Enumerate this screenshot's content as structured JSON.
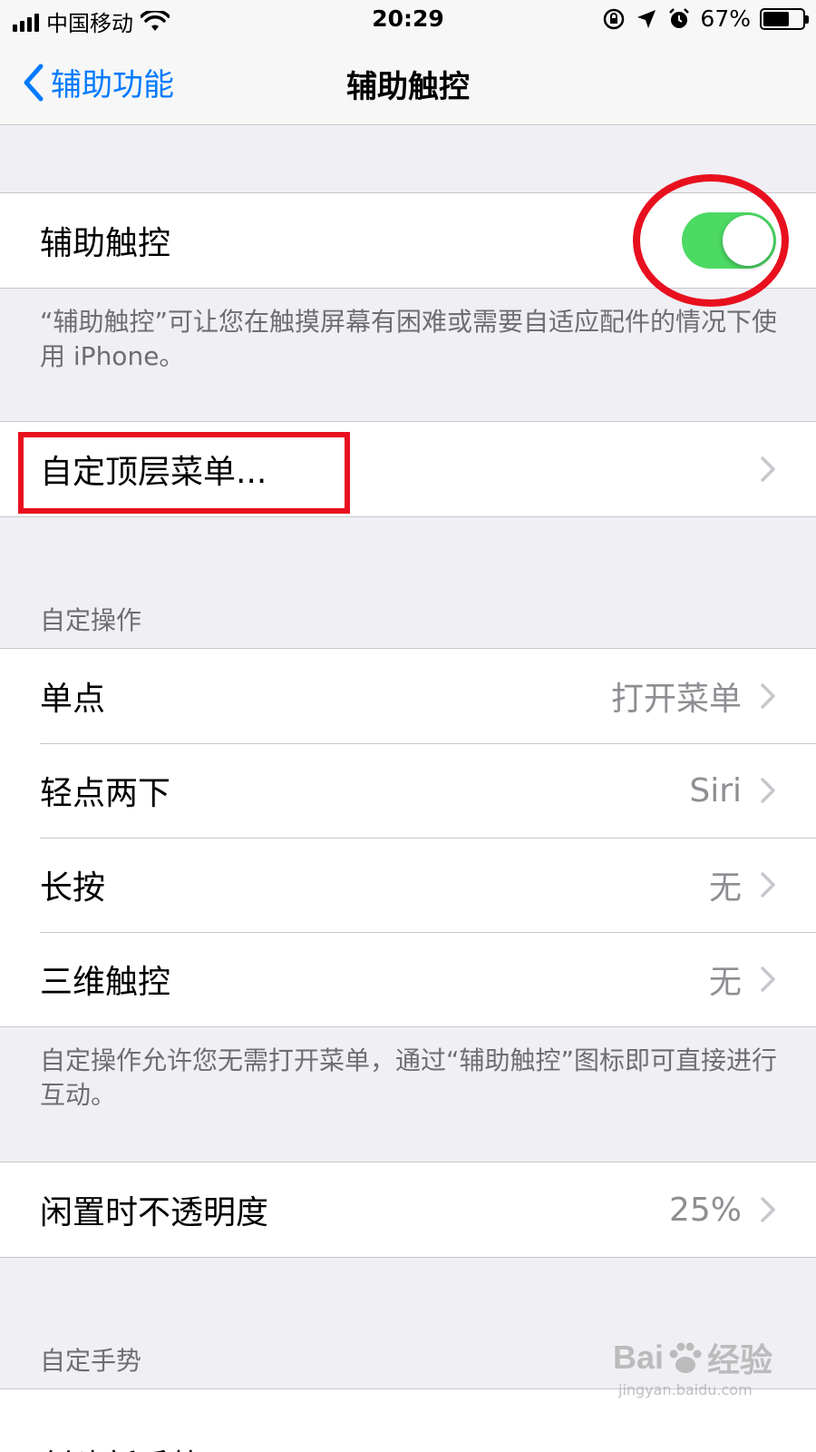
{
  "status_bar": {
    "carrier": "中国移动",
    "time": "20:29",
    "battery_percent": "67%",
    "battery_level": 0.67
  },
  "nav": {
    "back_label": "辅助功能",
    "title": "辅助触控"
  },
  "assistive_touch": {
    "label": "辅助触控",
    "enabled": true,
    "toggle_color": "#4cd964",
    "footer": "“辅助触控”可让您在触摸屏幕有困难或需要自适应配件的情况下使用 iPhone。"
  },
  "customize_menu": {
    "label": "自定顶层菜单..."
  },
  "custom_actions": {
    "header": "自定操作",
    "rows": [
      {
        "label": "单点",
        "value": "打开菜单"
      },
      {
        "label": "轻点两下",
        "value": "Siri"
      },
      {
        "label": "长按",
        "value": "无"
      },
      {
        "label": "三维触控",
        "value": "无"
      }
    ],
    "footer": "自定操作允许您无需打开菜单，通过“辅助触控”图标即可直接进行互动。"
  },
  "idle_opacity": {
    "label": "闲置时不透明度",
    "value": "25%"
  },
  "custom_gestures": {
    "header": "自定手势",
    "partial_row": "创建新手势"
  },
  "watermark": {
    "logo_left": "Bai",
    "logo_right": "经验",
    "sub": "jingyan.baidu.com"
  },
  "colors": {
    "accent": "#007aff",
    "annotation_red": "#e8101e",
    "background": "#efeff4"
  }
}
